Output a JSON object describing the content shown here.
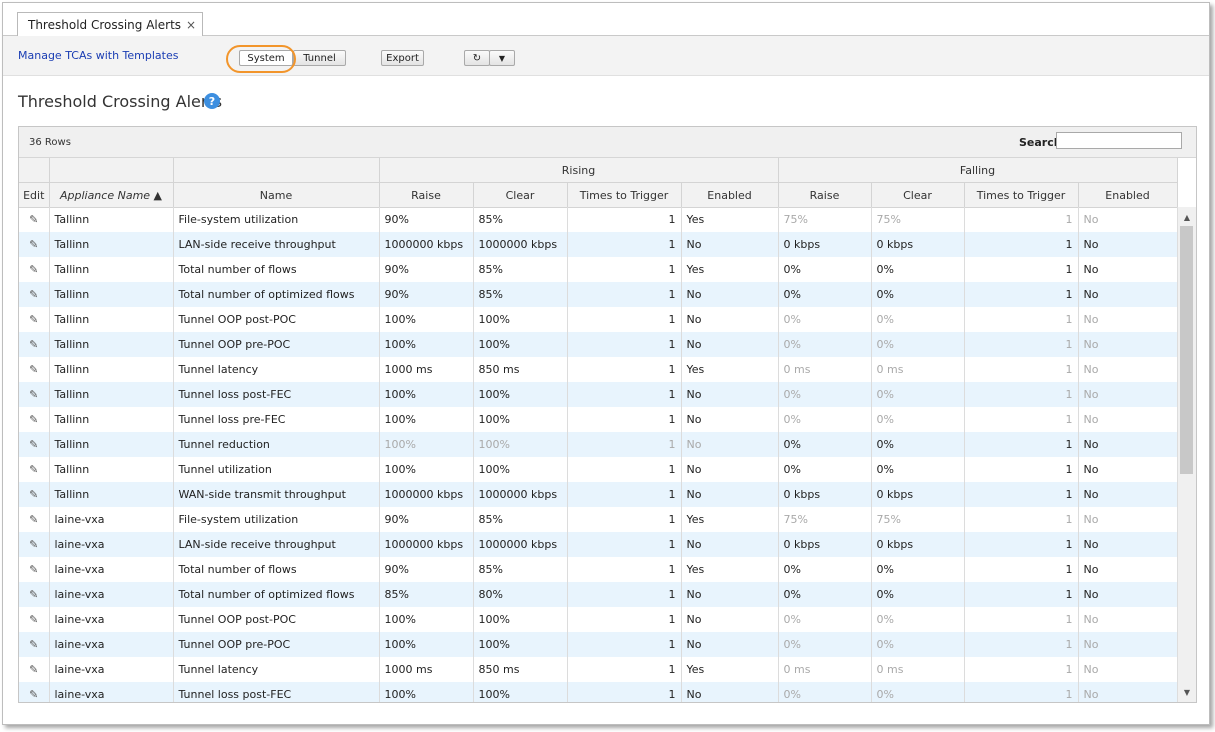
{
  "tab": {
    "title": "Threshold Crossing Alerts",
    "close_symbol": "×"
  },
  "toolbar": {
    "templates_link": "Manage TCAs with Templates",
    "system_label": "System",
    "tunnel_label": "Tunnel",
    "export_label": "Export",
    "refresh_symbol": "↻",
    "dropdown_symbol": "▼",
    "highlight_color": "#f2952b"
  },
  "page": {
    "title": "Threshold Crossing Alerts",
    "help_symbol": "?"
  },
  "grid": {
    "row_count_label": "36 Rows",
    "search_label": "Search",
    "search_value": "",
    "group_headers": {
      "rising": "Rising",
      "falling": "Falling"
    },
    "columns": {
      "edit": "Edit",
      "appliance": "Appliance Name ▲",
      "name": "Name",
      "r_raise": "Raise",
      "r_clear": "Clear",
      "r_times": "Times to Trigger",
      "r_enabled": "Enabled",
      "f_raise": "Raise",
      "f_clear": "Clear",
      "f_times": "Times to Trigger",
      "f_enabled": "Enabled"
    },
    "edit_icon_symbol": "✎",
    "rows": [
      {
        "appliance": "Tallinn",
        "name": "File-system utilization",
        "r_raise": "90%",
        "r_clear": "85%",
        "r_times": "1",
        "r_enabled": "Yes",
        "f_raise": "75%",
        "f_clear": "75%",
        "f_times": "1",
        "f_enabled": "No",
        "rising_muted": false,
        "falling_muted": true
      },
      {
        "appliance": "Tallinn",
        "name": "LAN-side receive throughput",
        "r_raise": "1000000 kbps",
        "r_clear": "1000000 kbps",
        "r_times": "1",
        "r_enabled": "No",
        "f_raise": "0 kbps",
        "f_clear": "0 kbps",
        "f_times": "1",
        "f_enabled": "No",
        "rising_muted": false,
        "falling_muted": false
      },
      {
        "appliance": "Tallinn",
        "name": "Total number of flows",
        "r_raise": "90%",
        "r_clear": "85%",
        "r_times": "1",
        "r_enabled": "Yes",
        "f_raise": "0%",
        "f_clear": "0%",
        "f_times": "1",
        "f_enabled": "No",
        "rising_muted": false,
        "falling_muted": false
      },
      {
        "appliance": "Tallinn",
        "name": "Total number of optimized flows",
        "r_raise": "90%",
        "r_clear": "85%",
        "r_times": "1",
        "r_enabled": "No",
        "f_raise": "0%",
        "f_clear": "0%",
        "f_times": "1",
        "f_enabled": "No",
        "rising_muted": false,
        "falling_muted": false
      },
      {
        "appliance": "Tallinn",
        "name": "Tunnel OOP post-POC",
        "r_raise": "100%",
        "r_clear": "100%",
        "r_times": "1",
        "r_enabled": "No",
        "f_raise": "0%",
        "f_clear": "0%",
        "f_times": "1",
        "f_enabled": "No",
        "rising_muted": false,
        "falling_muted": true
      },
      {
        "appliance": "Tallinn",
        "name": "Tunnel OOP pre-POC",
        "r_raise": "100%",
        "r_clear": "100%",
        "r_times": "1",
        "r_enabled": "No",
        "f_raise": "0%",
        "f_clear": "0%",
        "f_times": "1",
        "f_enabled": "No",
        "rising_muted": false,
        "falling_muted": true
      },
      {
        "appliance": "Tallinn",
        "name": "Tunnel latency",
        "r_raise": "1000 ms",
        "r_clear": "850 ms",
        "r_times": "1",
        "r_enabled": "Yes",
        "f_raise": "0 ms",
        "f_clear": "0 ms",
        "f_times": "1",
        "f_enabled": "No",
        "rising_muted": false,
        "falling_muted": true
      },
      {
        "appliance": "Tallinn",
        "name": "Tunnel loss post-FEC",
        "r_raise": "100%",
        "r_clear": "100%",
        "r_times": "1",
        "r_enabled": "No",
        "f_raise": "0%",
        "f_clear": "0%",
        "f_times": "1",
        "f_enabled": "No",
        "rising_muted": false,
        "falling_muted": true
      },
      {
        "appliance": "Tallinn",
        "name": "Tunnel loss pre-FEC",
        "r_raise": "100%",
        "r_clear": "100%",
        "r_times": "1",
        "r_enabled": "No",
        "f_raise": "0%",
        "f_clear": "0%",
        "f_times": "1",
        "f_enabled": "No",
        "rising_muted": false,
        "falling_muted": true
      },
      {
        "appliance": "Tallinn",
        "name": "Tunnel reduction",
        "r_raise": "100%",
        "r_clear": "100%",
        "r_times": "1",
        "r_enabled": "No",
        "f_raise": "0%",
        "f_clear": "0%",
        "f_times": "1",
        "f_enabled": "No",
        "rising_muted": true,
        "falling_muted": false
      },
      {
        "appliance": "Tallinn",
        "name": "Tunnel utilization",
        "r_raise": "100%",
        "r_clear": "100%",
        "r_times": "1",
        "r_enabled": "No",
        "f_raise": "0%",
        "f_clear": "0%",
        "f_times": "1",
        "f_enabled": "No",
        "rising_muted": false,
        "falling_muted": false
      },
      {
        "appliance": "Tallinn",
        "name": "WAN-side transmit throughput",
        "r_raise": "1000000 kbps",
        "r_clear": "1000000 kbps",
        "r_times": "1",
        "r_enabled": "No",
        "f_raise": "0 kbps",
        "f_clear": "0 kbps",
        "f_times": "1",
        "f_enabled": "No",
        "rising_muted": false,
        "falling_muted": false
      },
      {
        "appliance": "laine-vxa",
        "name": "File-system utilization",
        "r_raise": "90%",
        "r_clear": "85%",
        "r_times": "1",
        "r_enabled": "Yes",
        "f_raise": "75%",
        "f_clear": "75%",
        "f_times": "1",
        "f_enabled": "No",
        "rising_muted": false,
        "falling_muted": true
      },
      {
        "appliance": "laine-vxa",
        "name": "LAN-side receive throughput",
        "r_raise": "1000000 kbps",
        "r_clear": "1000000 kbps",
        "r_times": "1",
        "r_enabled": "No",
        "f_raise": "0 kbps",
        "f_clear": "0 kbps",
        "f_times": "1",
        "f_enabled": "No",
        "rising_muted": false,
        "falling_muted": false
      },
      {
        "appliance": "laine-vxa",
        "name": "Total number of flows",
        "r_raise": "90%",
        "r_clear": "85%",
        "r_times": "1",
        "r_enabled": "Yes",
        "f_raise": "0%",
        "f_clear": "0%",
        "f_times": "1",
        "f_enabled": "No",
        "rising_muted": false,
        "falling_muted": false
      },
      {
        "appliance": "laine-vxa",
        "name": "Total number of optimized flows",
        "r_raise": "85%",
        "r_clear": "80%",
        "r_times": "1",
        "r_enabled": "No",
        "f_raise": "0%",
        "f_clear": "0%",
        "f_times": "1",
        "f_enabled": "No",
        "rising_muted": false,
        "falling_muted": false
      },
      {
        "appliance": "laine-vxa",
        "name": "Tunnel OOP post-POC",
        "r_raise": "100%",
        "r_clear": "100%",
        "r_times": "1",
        "r_enabled": "No",
        "f_raise": "0%",
        "f_clear": "0%",
        "f_times": "1",
        "f_enabled": "No",
        "rising_muted": false,
        "falling_muted": true
      },
      {
        "appliance": "laine-vxa",
        "name": "Tunnel OOP pre-POC",
        "r_raise": "100%",
        "r_clear": "100%",
        "r_times": "1",
        "r_enabled": "No",
        "f_raise": "0%",
        "f_clear": "0%",
        "f_times": "1",
        "f_enabled": "No",
        "rising_muted": false,
        "falling_muted": true
      },
      {
        "appliance": "laine-vxa",
        "name": "Tunnel latency",
        "r_raise": "1000 ms",
        "r_clear": "850 ms",
        "r_times": "1",
        "r_enabled": "Yes",
        "f_raise": "0 ms",
        "f_clear": "0 ms",
        "f_times": "1",
        "f_enabled": "No",
        "rising_muted": false,
        "falling_muted": true
      },
      {
        "appliance": "laine-vxa",
        "name": "Tunnel loss post-FEC",
        "r_raise": "100%",
        "r_clear": "100%",
        "r_times": "1",
        "r_enabled": "No",
        "f_raise": "0%",
        "f_clear": "0%",
        "f_times": "1",
        "f_enabled": "No",
        "rising_muted": false,
        "falling_muted": true
      }
    ]
  }
}
